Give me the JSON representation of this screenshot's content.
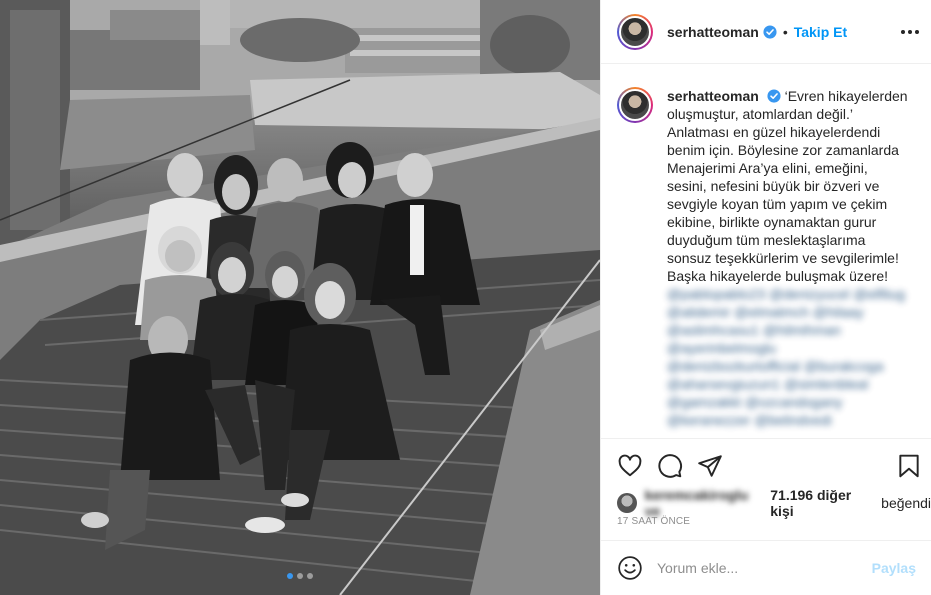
{
  "post": {
    "username": "serhatteoman",
    "follow_label": "Takip Et",
    "separator": "•",
    "caption_lines": [
      "‘Evren hikayelerden",
      "oluşmuştur, atomlardan değil.’",
      "Anlatması en güzel hikayelerdendi",
      "benim için. Böylesine zor zamanlarda",
      "Menajerimi Ara’ya elini, emeğini,",
      "sesini, nefesini büyük bir özveri ve",
      "sevgiyle koyan tüm yapım ve çekim",
      "ekibine, birlikte oynamaktan gurur",
      "duyduğum tüm meslektaşlarıma",
      "sonsuz teşekkürlerim ve sevgilerimle!",
      "Başka hikayelerde buluşmak üzere!"
    ],
    "mentions": [
      "@pablopablo23 @denizyucel @elfitug",
      "@alidemir @elmatmch @hilaay",
      "@aslimhcasu1 @hilmihman",
      "@ayerinbelmoglu",
      "@denizbozkurtofficial @burakcoga",
      "@aharsevgiuzun1 @simlenbleal",
      "@gamzakkt @ozcandogany",
      "@keranezzer @belindvedi"
    ],
    "likes": {
      "liker_name": "keremcakiroglu ve",
      "count_label": "71.196 diğer kişi",
      "suffix": "beğendi"
    },
    "time_ago": "17 SAAT ÖNCE",
    "comment": {
      "placeholder": "Yorum ekle...",
      "post_label": "Paylaş"
    }
  },
  "colors": {
    "accent": "#0095f6",
    "verified": "#3897f0",
    "muted": "#8e8e8e",
    "post_disabled": "#b2dffc"
  },
  "icons": [
    "more-icon",
    "verified-icon",
    "heart-icon",
    "comment-icon",
    "share-icon",
    "bookmark-icon",
    "emoji-icon"
  ],
  "carousel": {
    "count": 3,
    "active_index": 0
  }
}
